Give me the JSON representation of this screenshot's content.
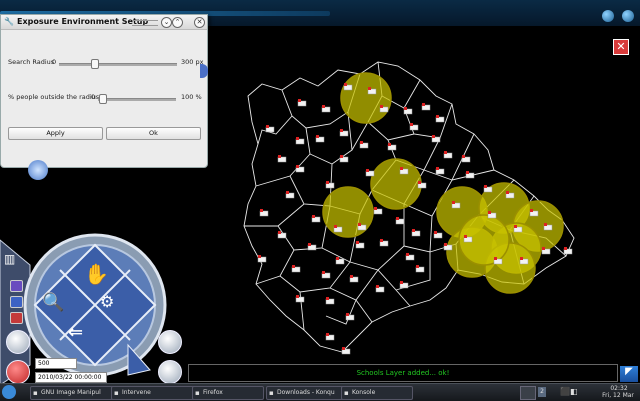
{
  "dialog": {
    "title": "Exposure Environment Setup",
    "radius": {
      "label": "Search Radius",
      "min": "0",
      "max": "300 px",
      "value_fraction": 0.3
    },
    "outside": {
      "label": "% people outside the radius",
      "min": "0",
      "max": "100 %",
      "value_fraction": 0.05
    },
    "apply_label": "Apply",
    "ok_label": "Ok"
  },
  "controls": {
    "number_value": "500",
    "date_value": "2010/03/22 00:00:00"
  },
  "status": {
    "message": "Schools Layer added... ok!"
  },
  "map": {
    "exposure_zones": 10,
    "zone_color": "#c9c400",
    "school_icon": "school-icon"
  },
  "taskbar": {
    "tasks": [
      {
        "label": "GNU Image Manipul"
      },
      {
        "label": "Intervene"
      },
      {
        "label": "Firefox"
      },
      {
        "label": "Downloads - Konqu"
      },
      {
        "label": "Konsole"
      }
    ],
    "workspace": "2",
    "time": "02:32",
    "date": "Fri, 12 Mar"
  },
  "colors": {
    "accent": "#1f6fa5",
    "status_text": "#22c722",
    "close_button": "#d83a3a"
  }
}
